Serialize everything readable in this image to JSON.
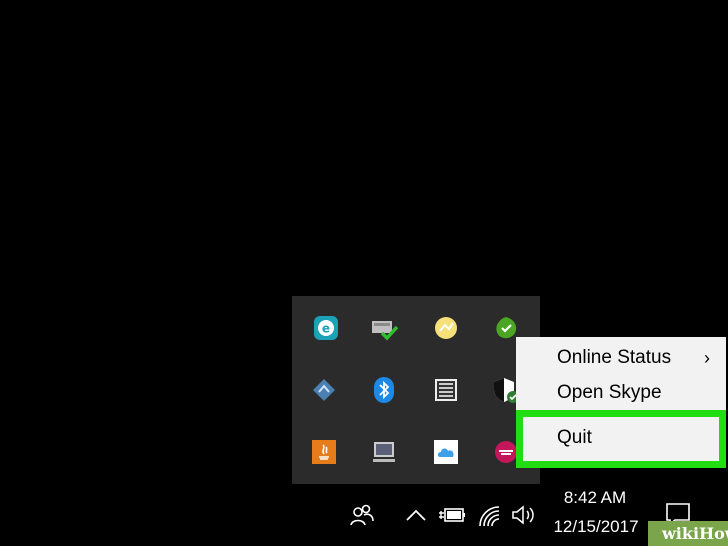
{
  "context_menu": {
    "items": [
      {
        "label": "Online Status",
        "has_submenu": true
      },
      {
        "label": "Open Skype"
      },
      {
        "label": "Quit"
      }
    ],
    "chevron": "›",
    "highlight_color": "#22dd11"
  },
  "taskbar": {
    "time": "8:42 AM",
    "date": "12/15/2017"
  },
  "tray_icons": [
    "eset-icon",
    "device-check-icon",
    "yellow-app-icon",
    "green-check-app-icon",
    "network-drive-icon",
    "bluetooth-icon",
    "calculator-icon",
    "security-shield-icon",
    "java-icon",
    "display-icon",
    "cloud-icon",
    "skype-icon"
  ],
  "watermark": "wikiHow"
}
